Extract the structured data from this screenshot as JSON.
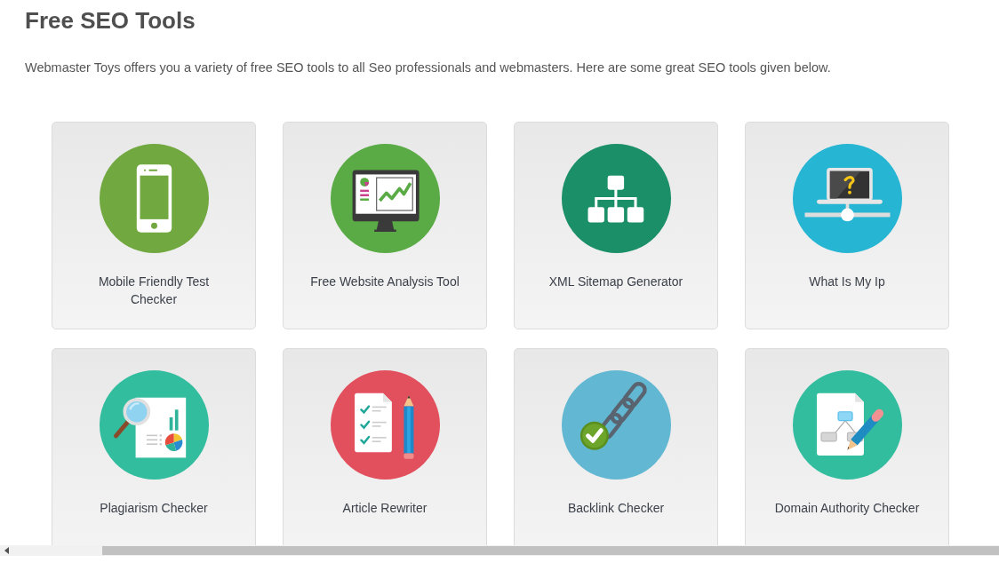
{
  "page": {
    "title": "Free SEO Tools",
    "intro": "Webmaster Toys offers you a variety of free SEO tools to all Seo professionals and webmasters. Here are some great SEO tools given below."
  },
  "tools": [
    {
      "label": "Mobile Friendly Test Checker",
      "kind": "phone",
      "color": "#71a840"
    },
    {
      "label": "Free Website Analysis Tool",
      "kind": "monitor",
      "color": "#5aab45"
    },
    {
      "label": "XML Sitemap Generator",
      "kind": "sitemap",
      "color": "#1b8f68"
    },
    {
      "label": "What Is My Ip",
      "kind": "laptop",
      "color": "#26b5d3"
    },
    {
      "label": "Plagiarism Checker",
      "kind": "magnifier",
      "color": "#33bd9f"
    },
    {
      "label": "Article Rewriter",
      "kind": "checklist",
      "color": "#e2505e"
    },
    {
      "label": "Backlink Checker",
      "kind": "chain",
      "color": "#62b8d2"
    },
    {
      "label": "Domain Authority Checker",
      "kind": "document",
      "color": "#33bd9f"
    }
  ]
}
